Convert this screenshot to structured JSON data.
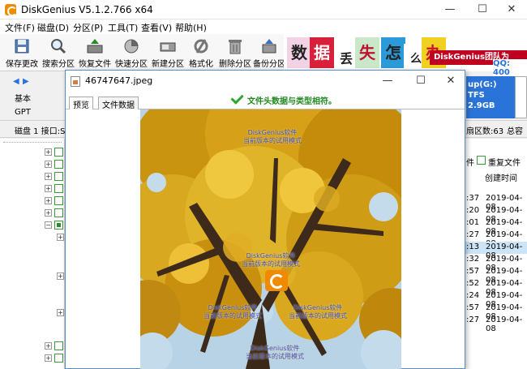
{
  "app": {
    "title": "DiskGenius V5.1.2.766 x64"
  },
  "menu": [
    "文件(F)",
    "磁盘(D)",
    "分区(P)",
    "工具(T)",
    "查看(V)",
    "帮助(H)"
  ],
  "toolbar": [
    "保存更改",
    "搜索分区",
    "恢复文件",
    "快速分区",
    "新建分区",
    "格式化",
    "删除分区",
    "备份分区"
  ],
  "banner": {
    "chars": [
      "数",
      "据",
      "丢",
      "失",
      "怎",
      "么",
      "办"
    ],
    "slogan": "DiskGenius团队为",
    "qq": "QQ: 400"
  },
  "left_nav": {
    "basic": "基本",
    "gpt": "GPT",
    "disk_info": "磁盘 1 接口:S"
  },
  "disk_partition": {
    "label": "up(G:)",
    "fs": "TFS",
    "size": "2.9GB"
  },
  "info_row": {
    "sectors": "扇区数:63",
    "total": "总容"
  },
  "file_list": {
    "header_left": "件",
    "header_checkbox_label": "重复文件",
    "col_created": "创建时间",
    "rows": [
      {
        "time": ":37",
        "date": "2019-04-08"
      },
      {
        "time": ":20",
        "date": "2019-04-08"
      },
      {
        "time": ":01",
        "date": "2019-04-08"
      },
      {
        "time": ":27",
        "date": "2019-04-08"
      },
      {
        "time": ":13",
        "date": "2019-04-08"
      },
      {
        "time": ":32",
        "date": "2019-04-08"
      },
      {
        "time": ":57",
        "date": "2019-04-08"
      },
      {
        "time": ":52",
        "date": "2019-04-08"
      },
      {
        "time": ":24",
        "date": "2019-04-08"
      },
      {
        "time": ":57",
        "date": "2019-04-08"
      },
      {
        "time": ":27",
        "date": "2019-04-08"
      }
    ]
  },
  "dialog": {
    "filename": "46747647.jpeg",
    "tabs": [
      "预览",
      "文件数据"
    ],
    "status": "文件头数据与类型相符。",
    "watermark_line1": "DiskGenius软件",
    "watermark_line2": "当前版本的试用模式"
  },
  "colors": {
    "accent_blue": "#2a73d8",
    "status_green": "#1f8a1f",
    "tree_green": "#3a9a3a",
    "logo_orange": "#f08a00"
  }
}
